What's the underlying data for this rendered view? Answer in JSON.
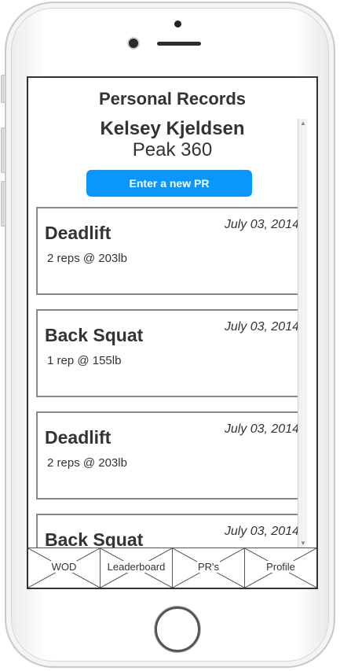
{
  "header": {
    "title": "Personal Records",
    "athlete_name": "Kelsey Kjeldsen",
    "gym_name": "Peak 360"
  },
  "actions": {
    "enter_pr_label": "Enter a new PR"
  },
  "records": [
    {
      "exercise": "Deadlift",
      "date": "July 03, 2014",
      "detail": "2 reps @ 203lb"
    },
    {
      "exercise": "Back Squat",
      "date": "July 03, 2014",
      "detail": "1 rep @ 155lb"
    },
    {
      "exercise": "Deadlift",
      "date": "July 03, 2014",
      "detail": "2 reps @ 203lb"
    },
    {
      "exercise": "Back Squat",
      "date": "July 03, 2014",
      "detail": ""
    }
  ],
  "tabs": [
    {
      "label": "WOD"
    },
    {
      "label": "Leaderboard"
    },
    {
      "label": "PR's"
    },
    {
      "label": "Profile"
    }
  ],
  "colors": {
    "accent": "#0b96fb",
    "text": "#333333",
    "card_border": "#888888"
  }
}
